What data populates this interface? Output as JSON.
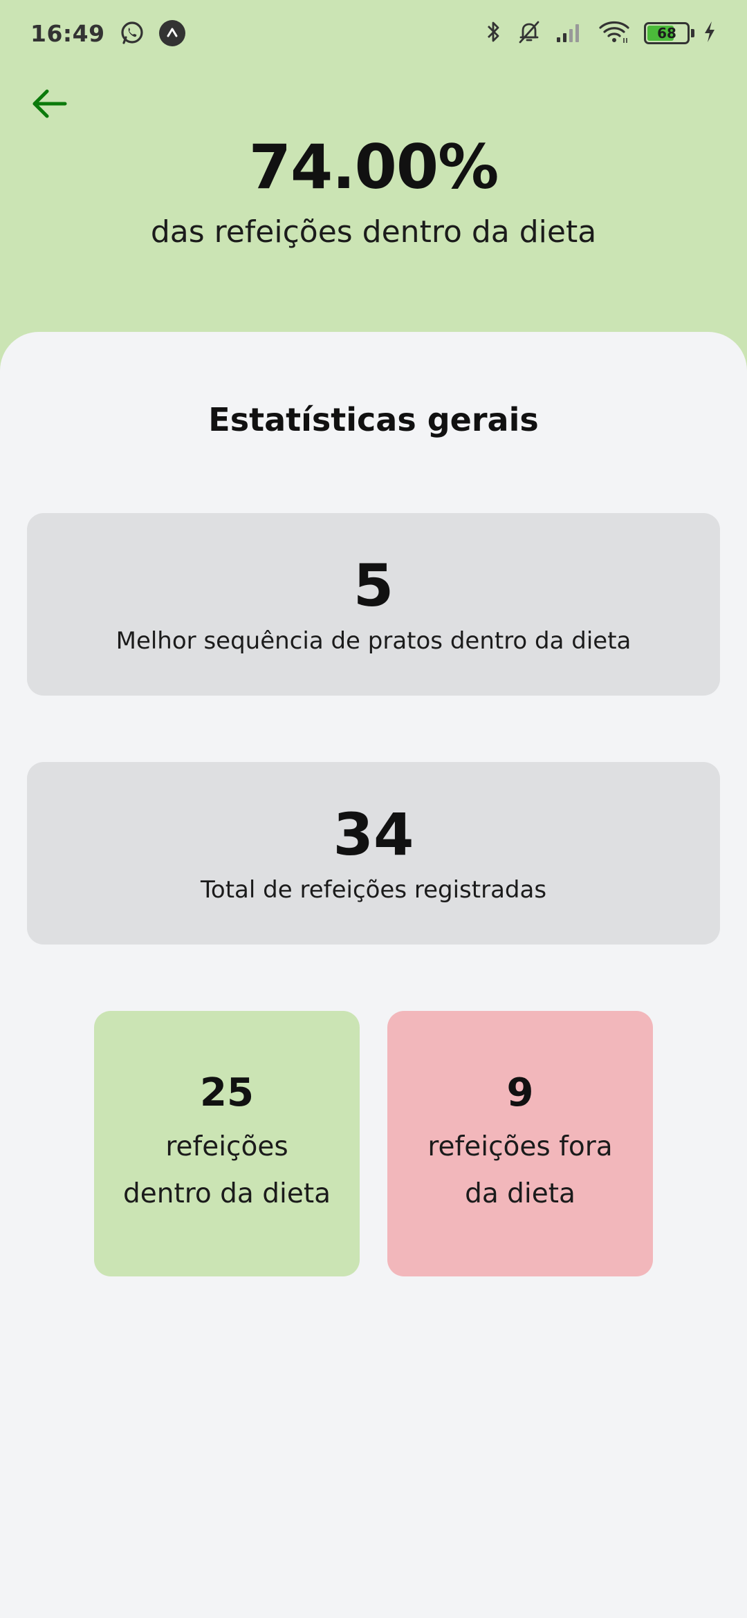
{
  "status_bar": {
    "time": "16:49",
    "battery_level": "68",
    "battery_fraction": 0.68,
    "icons": [
      "whatsapp-icon",
      "app-notification-icon",
      "bluetooth-icon",
      "muted-bell-icon",
      "signal-icon",
      "wifi-icon",
      "battery-icon",
      "charging-icon"
    ]
  },
  "header": {
    "back_icon": "arrow-left-icon",
    "percent": "74.00%",
    "subtitle": "das refeições dentro da dieta",
    "accent_color": "#0B7A0B",
    "background_color": "#CBE4B4"
  },
  "stats": {
    "title": "Estatísticas gerais",
    "best_sequence": {
      "value": "5",
      "label": "Melhor sequência de pratos dentro da dieta"
    },
    "total_meals": {
      "value": "34",
      "label": "Total de refeições registradas"
    },
    "within_diet": {
      "value": "25",
      "line1": "refeições",
      "line2": "dentro da dieta",
      "color": "#CBE4B4"
    },
    "outside_diet": {
      "value": "9",
      "line1": "refeições fora",
      "line2": "da dieta",
      "color": "#F2B7BB"
    }
  }
}
